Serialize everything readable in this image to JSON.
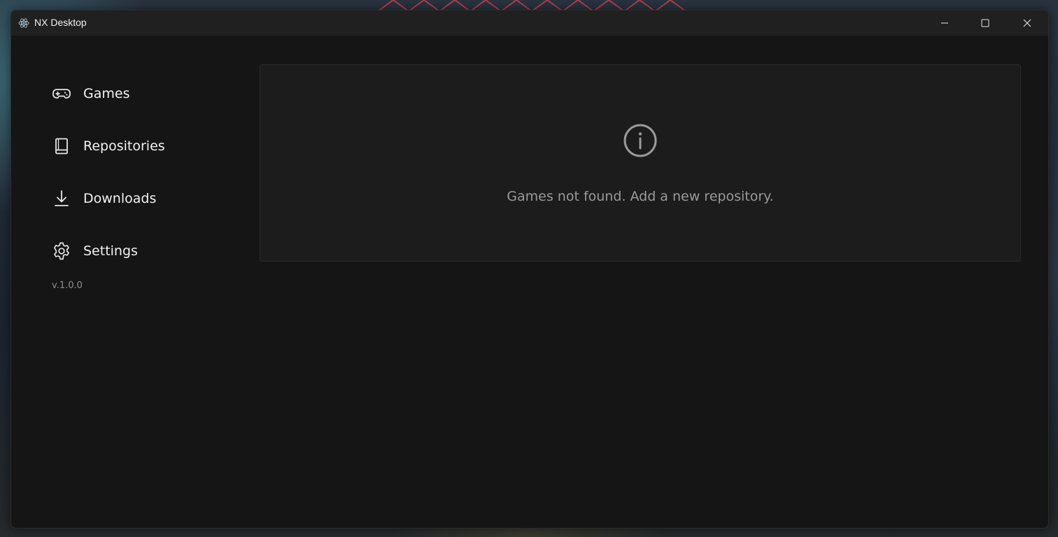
{
  "window": {
    "title": "NX Desktop",
    "icons": {
      "app": "electron-logo-icon",
      "minimize": "minimize-icon",
      "maximize": "maximize-icon",
      "close": "close-icon"
    }
  },
  "sidebar": {
    "items": [
      {
        "label": "Games",
        "icon": "gamepad-icon"
      },
      {
        "label": "Repositories",
        "icon": "book-icon"
      },
      {
        "label": "Downloads",
        "icon": "download-icon"
      },
      {
        "label": "Settings",
        "icon": "gear-icon"
      }
    ],
    "version": "v.1.0.0"
  },
  "main": {
    "empty_state": {
      "icon": "info-circle-icon",
      "message": "Games not found. Add a new repository."
    }
  },
  "colors": {
    "window_bg": "#151515",
    "titlebar_bg": "#202020",
    "card_bg": "#1c1c1c",
    "text_primary": "#f2f2f2",
    "text_muted": "#9a9a9a"
  }
}
